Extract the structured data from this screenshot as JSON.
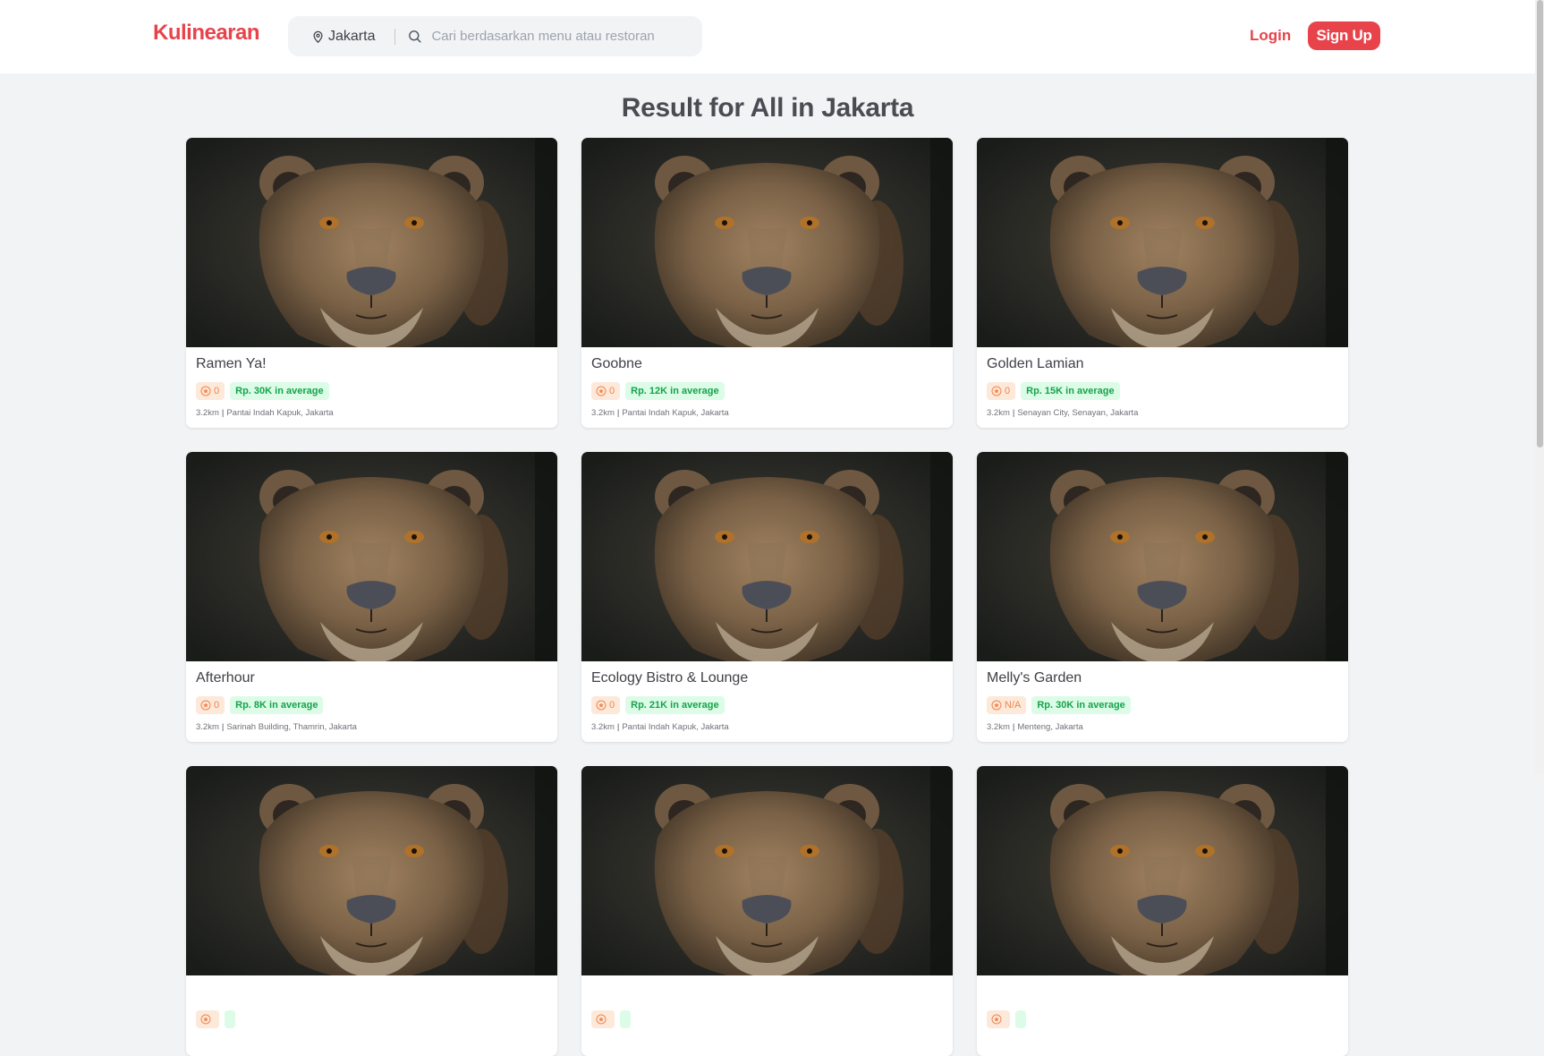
{
  "header": {
    "logo": "Kulinearan",
    "location": "Jakarta",
    "search_placeholder": "Cari berdasarkan menu atau restoran",
    "login_label": "Login",
    "signup_label": "Sign Up"
  },
  "page_title": "Result for All in Jakarta",
  "colors": {
    "brand": "#e8434b",
    "price_green": "#16a34a",
    "rating_orange": "#f0844c"
  },
  "restaurants": [
    {
      "name": "Ramen Ya!",
      "rating": "0",
      "price": "Rp. 30K in average",
      "distance": "3.2km",
      "separator": "|",
      "location": "Pantai Indah Kapuk, Jakarta"
    },
    {
      "name": "Goobne",
      "rating": "0",
      "price": "Rp. 12K in average",
      "distance": "3.2km",
      "separator": "|",
      "location": "Pantai Indah Kapuk, Jakarta"
    },
    {
      "name": "Golden Lamian",
      "rating": "0",
      "price": "Rp. 15K in average",
      "distance": "3.2km",
      "separator": "|",
      "location": "Senayan City, Senayan, Jakarta"
    },
    {
      "name": "Afterhour",
      "rating": "0",
      "price": "Rp. 8K in average",
      "distance": "3.2km",
      "separator": "|",
      "location": "Sarinah Building, Thamrin, Jakarta"
    },
    {
      "name": "Ecology Bistro & Lounge",
      "rating": "0",
      "price": "Rp. 21K in average",
      "distance": "3.2km",
      "separator": "|",
      "location": "Pantai Indah Kapuk, Jakarta"
    },
    {
      "name": "Melly's Garden",
      "rating": "N/A",
      "price": "Rp. 30K in average",
      "distance": "3.2km",
      "separator": "|",
      "location": "Menteng, Jakarta"
    },
    {
      "name": "",
      "rating": "",
      "price": "",
      "distance": "",
      "separator": "",
      "location": ""
    },
    {
      "name": "",
      "rating": "",
      "price": "",
      "distance": "",
      "separator": "",
      "location": ""
    },
    {
      "name": "",
      "rating": "",
      "price": "",
      "distance": "",
      "separator": "",
      "location": ""
    }
  ]
}
